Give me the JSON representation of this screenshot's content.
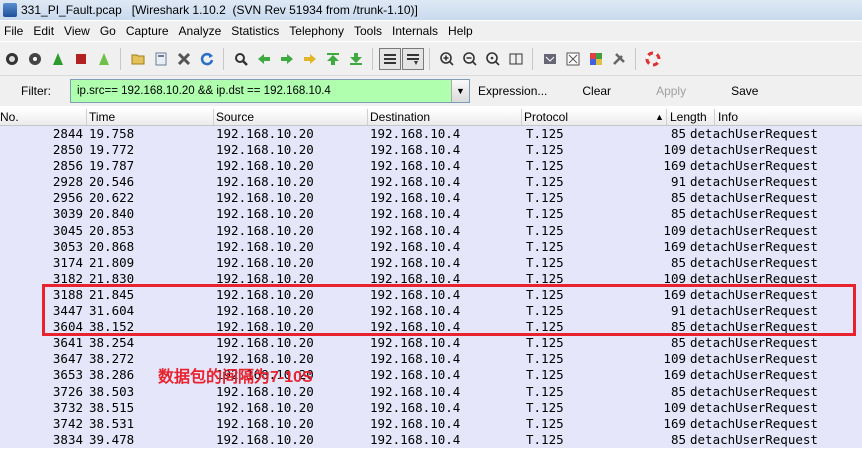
{
  "window": {
    "title": "331_PI_Fault.pcap   [Wireshark 1.10.2  (SVN Rev 51934 from /trunk-1.10)]"
  },
  "menu": [
    "File",
    "Edit",
    "View",
    "Go",
    "Capture",
    "Analyze",
    "Statistics",
    "Telephony",
    "Tools",
    "Internals",
    "Help"
  ],
  "toolbar": {
    "groups": [
      [
        "interface-list-icon",
        "capture-options-icon",
        "start-capture-icon",
        "stop-capture-icon",
        "restart-capture-icon"
      ],
      [
        "open-file-icon",
        "save-file-icon",
        "close-file-icon",
        "reload-icon"
      ],
      [
        "find-packet-icon",
        "go-back-icon",
        "go-forward-icon",
        "go-to-packet-icon",
        "go-first-icon",
        "go-last-icon"
      ],
      [
        "colorize-icon",
        "auto-scroll-icon"
      ],
      [
        "zoom-in-icon",
        "zoom-out-icon",
        "zoom-normal-icon",
        "resize-columns-icon"
      ],
      [
        "capture-filters-icon",
        "display-filters-icon",
        "coloring-rules-icon",
        "preferences-icon"
      ],
      [
        "help-icon"
      ]
    ]
  },
  "filter": {
    "label": "Filter:",
    "value": "ip.src== 192.168.10.20 && ip.dst == 192.168.10.4",
    "expression": "Expression...",
    "clear": "Clear",
    "apply": "Apply",
    "save": "Save"
  },
  "columns": {
    "no": "No.",
    "time": "Time",
    "source": "Source",
    "destination": "Destination",
    "protocol": "Protocol",
    "length": "Length",
    "info": "Info"
  },
  "packets": [
    {
      "no": "2844",
      "time": "19.758",
      "src": "192.168.10.20",
      "dst": "192.168.10.4",
      "proto": "T.125",
      "len": "85",
      "info": "detachUserRequest"
    },
    {
      "no": "2850",
      "time": "19.772",
      "src": "192.168.10.20",
      "dst": "192.168.10.4",
      "proto": "T.125",
      "len": "109",
      "info": "detachUserRequest"
    },
    {
      "no": "2856",
      "time": "19.787",
      "src": "192.168.10.20",
      "dst": "192.168.10.4",
      "proto": "T.125",
      "len": "169",
      "info": "detachUserRequest"
    },
    {
      "no": "2928",
      "time": "20.546",
      "src": "192.168.10.20",
      "dst": "192.168.10.4",
      "proto": "T.125",
      "len": "91",
      "info": "detachUserRequest"
    },
    {
      "no": "2956",
      "time": "20.622",
      "src": "192.168.10.20",
      "dst": "192.168.10.4",
      "proto": "T.125",
      "len": "85",
      "info": "detachUserRequest"
    },
    {
      "no": "3039",
      "time": "20.840",
      "src": "192.168.10.20",
      "dst": "192.168.10.4",
      "proto": "T.125",
      "len": "85",
      "info": "detachUserRequest"
    },
    {
      "no": "3045",
      "time": "20.853",
      "src": "192.168.10.20",
      "dst": "192.168.10.4",
      "proto": "T.125",
      "len": "109",
      "info": "detachUserRequest"
    },
    {
      "no": "3053",
      "time": "20.868",
      "src": "192.168.10.20",
      "dst": "192.168.10.4",
      "proto": "T.125",
      "len": "169",
      "info": "detachUserRequest"
    },
    {
      "no": "3174",
      "time": "21.809",
      "src": "192.168.10.20",
      "dst": "192.168.10.4",
      "proto": "T.125",
      "len": "85",
      "info": "detachUserRequest"
    },
    {
      "no": "3182",
      "time": "21.830",
      "src": "192.168.10.20",
      "dst": "192.168.10.4",
      "proto": "T.125",
      "len": "109",
      "info": "detachUserRequest"
    },
    {
      "no": "3188",
      "time": "21.845",
      "src": "192.168.10.20",
      "dst": "192.168.10.4",
      "proto": "T.125",
      "len": "169",
      "info": "detachUserRequest"
    },
    {
      "no": "3447",
      "time": "31.604",
      "src": "192.168.10.20",
      "dst": "192.168.10.4",
      "proto": "T.125",
      "len": "91",
      "info": "detachUserRequest"
    },
    {
      "no": "3604",
      "time": "38.152",
      "src": "192.168.10.20",
      "dst": "192.168.10.4",
      "proto": "T.125",
      "len": "85",
      "info": "detachUserRequest"
    },
    {
      "no": "3641",
      "time": "38.254",
      "src": "192.168.10.20",
      "dst": "192.168.10.4",
      "proto": "T.125",
      "len": "85",
      "info": "detachUserRequest"
    },
    {
      "no": "3647",
      "time": "38.272",
      "src": "192.168.10.20",
      "dst": "192.168.10.4",
      "proto": "T.125",
      "len": "109",
      "info": "detachUserRequest"
    },
    {
      "no": "3653",
      "time": "38.286",
      "src": "192.168.10.20",
      "dst": "192.168.10.4",
      "proto": "T.125",
      "len": "169",
      "info": "detachUserRequest"
    },
    {
      "no": "3726",
      "time": "38.503",
      "src": "192.168.10.20",
      "dst": "192.168.10.4",
      "proto": "T.125",
      "len": "85",
      "info": "detachUserRequest"
    },
    {
      "no": "3732",
      "time": "38.515",
      "src": "192.168.10.20",
      "dst": "192.168.10.4",
      "proto": "T.125",
      "len": "109",
      "info": "detachUserRequest"
    },
    {
      "no": "3742",
      "time": "38.531",
      "src": "192.168.10.20",
      "dst": "192.168.10.4",
      "proto": "T.125",
      "len": "169",
      "info": "detachUserRequest"
    },
    {
      "no": "3834",
      "time": "39.478",
      "src": "192.168.10.20",
      "dst": "192.168.10.4",
      "proto": "T.125",
      "len": "85",
      "info": "detachUserRequest"
    }
  ],
  "annotation": {
    "text": "数据包的间隔为7-10S",
    "color": "#e8232e"
  },
  "colors": {
    "row_background": "#e6e6fa",
    "filter_valid": "#afffaf"
  }
}
